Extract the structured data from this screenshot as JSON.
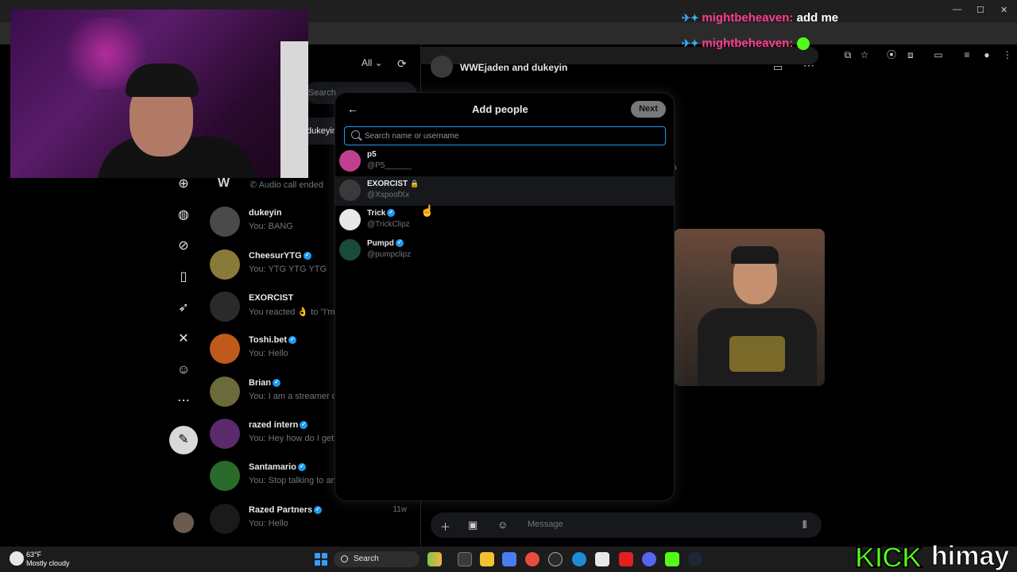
{
  "browser": {
    "window_controls": [
      "—",
      "☐",
      "✕"
    ]
  },
  "stream_chat": [
    {
      "user": "mightbeheaven:",
      "message": "add me",
      "has_emote": false
    },
    {
      "user": "mightbeheaven:",
      "message": "",
      "has_emote": true
    }
  ],
  "messages": {
    "filter_label": "All",
    "search_placeholder": "Search",
    "selected_conversation": "dukeyin",
    "group_call_status": "Audio call ended",
    "conversations": [
      {
        "name": "dukeyin",
        "preview": "You: BANG",
        "time": "",
        "verified": false,
        "avatar_color": "#4a4a4a"
      },
      {
        "name": "CheesurYTG",
        "preview": "You: YTG YTG YTG",
        "time": "",
        "verified": true,
        "avatar_color": "#8a7a3a"
      },
      {
        "name": "EXORCIST",
        "preview": "You reacted 👌 to \"I'm a",
        "time": "",
        "verified": false,
        "avatar_color": "#2a2a2a"
      },
      {
        "name": "Toshi.bet",
        "preview": "You: Hello",
        "time": "",
        "verified": true,
        "avatar_color": "#c05a1a"
      },
      {
        "name": "Brian",
        "preview": "You: I am a streamer on",
        "time": "",
        "verified": true,
        "avatar_color": "#6a6a3a"
      },
      {
        "name": "razed intern",
        "preview": "You: Hey how do I get in",
        "time": "",
        "verified": true,
        "avatar_color": "#5a2a6a"
      },
      {
        "name": "Santamario",
        "preview": "You: Stop talking to and",
        "time": "",
        "verified": true,
        "avatar_color": "#2a6a2a"
      },
      {
        "name": "Razed Partners",
        "preview": "You: Hello",
        "time": "11w",
        "verified": true,
        "avatar_color": "#1a1a1a"
      }
    ]
  },
  "conversation": {
    "title": "WWEjaden and dukeyin",
    "stray_text": "n",
    "composer_placeholder": "Message"
  },
  "modal": {
    "title": "Add people",
    "next_label": "Next",
    "search_placeholder": "Search name or username",
    "results": [
      {
        "name": "p5",
        "handle": "@P5______",
        "verified": false,
        "locked": false,
        "avatar_color": "#c04090"
      },
      {
        "name": "EXORCIST",
        "handle": "@XspoofXx",
        "verified": false,
        "locked": true,
        "avatar_color": "#3a3a3a"
      },
      {
        "name": "Trick",
        "handle": "@TrickClipz",
        "verified": true,
        "locked": false,
        "avatar_color": "#e8e8e8"
      },
      {
        "name": "Pumpd",
        "handle": "@pumpclipz",
        "verified": true,
        "locked": false,
        "avatar_color": "#1a4a3a"
      }
    ]
  },
  "taskbar": {
    "temperature": "63°F",
    "weather": "Mostly cloudy",
    "search_label": "Search"
  },
  "kick": {
    "brand": "KICK",
    "channel": "himay"
  },
  "colors": {
    "accent_blue": "#1d9bf0",
    "kick_green": "#53fc18",
    "chat_user": "#ff3d8b"
  }
}
